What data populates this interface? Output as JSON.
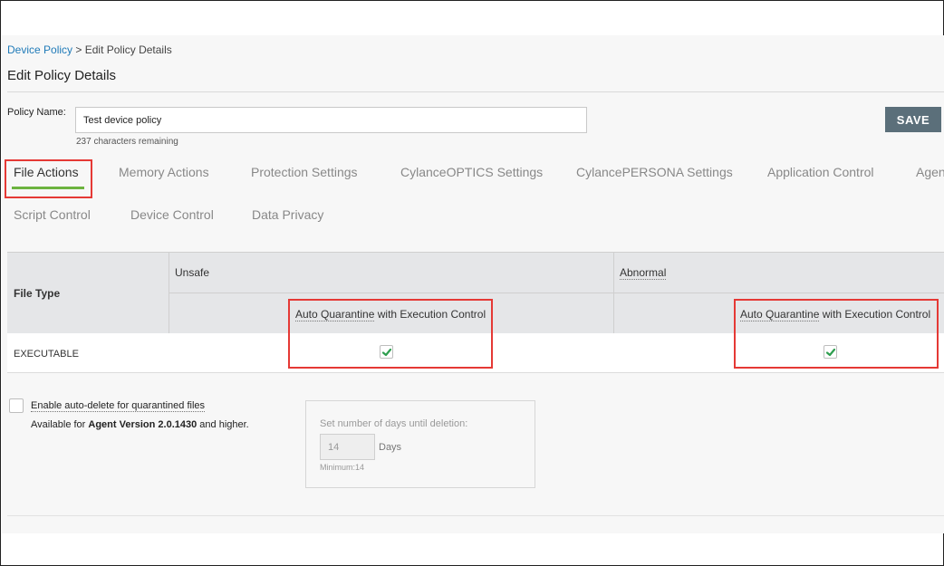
{
  "breadcrumb": {
    "root": "Device Policy",
    "separator": " > ",
    "current": "Edit Policy Details"
  },
  "page_title": "Edit Policy Details",
  "policy": {
    "label": "Policy Name:",
    "value": "Test device policy",
    "chars_remaining": "237 characters remaining",
    "save_label": "SAVE"
  },
  "tabs": [
    {
      "label": "File Actions",
      "active": true
    },
    {
      "label": "Memory Actions"
    },
    {
      "label": "Protection Settings"
    },
    {
      "label": "CylanceOPTICS Settings"
    },
    {
      "label": "CylancePERSONA Settings"
    },
    {
      "label": "Application Control"
    },
    {
      "label": "Agen"
    },
    {
      "label": "Script Control"
    },
    {
      "label": "Device Control"
    },
    {
      "label": "Data Privacy"
    }
  ],
  "table": {
    "file_type_header": "File Type",
    "unsafe_header": "Unsafe",
    "abnormal_header": "Abnormal",
    "unsafe_sub": {
      "part1": "Auto Quarantine",
      "part2": " with Execution Control"
    },
    "abnormal_sub": {
      "part1": "Auto Quarantine",
      "part2": " with Execution Control"
    },
    "rows": [
      {
        "file_type": "EXECUTABLE",
        "unsafe_checked": true,
        "abnormal_checked": true
      }
    ]
  },
  "auto_delete": {
    "label": "Enable auto-delete for quarantined files",
    "checked": false,
    "available_prefix": "Available for ",
    "available_version": "Agent Version 2.0.1430",
    "available_suffix": " and higher.",
    "days_label": "Set number of days until deletion:",
    "days_value": "14",
    "days_unit": "Days",
    "days_min": "Minimum:14"
  },
  "colors": {
    "link": "#1f7ab8",
    "save_button": "#5b6f7a",
    "tab_active_underline": "#6cb33f",
    "highlight_box": "#e53935",
    "checkmark": "#2e9e4f"
  }
}
